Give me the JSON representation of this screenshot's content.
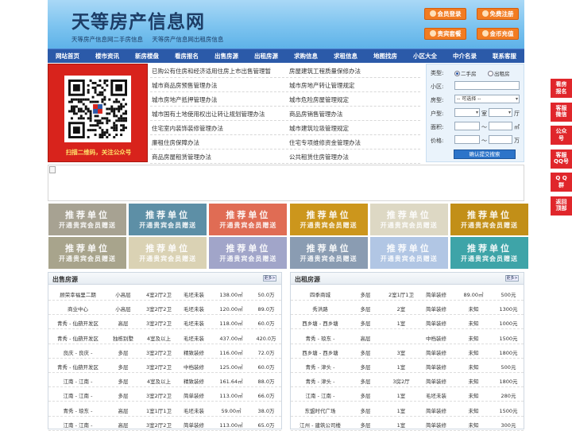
{
  "header": {
    "title": "天等房产信息网",
    "subtitle": [
      "天等房产信息网二手房信息",
      "天等房产信息网出租房信息"
    ],
    "buttons": [
      {
        "label": "会员登录",
        "icon": "user-icon"
      },
      {
        "label": "免费注册",
        "icon": "register-icon"
      },
      {
        "label": "贵宾套餐",
        "icon": "vip-icon"
      },
      {
        "label": "金币充值",
        "icon": "coin-icon"
      }
    ]
  },
  "nav": [
    "网站首页",
    "楼市资讯",
    "新房楼盘",
    "看房报名",
    "出售房源",
    "出租房源",
    "求购信息",
    "求租信息",
    "地图找房",
    "小区大全",
    "中介名录",
    "联系客服"
  ],
  "qr": {
    "caption": "扫描二维码，关注公众号"
  },
  "links": {
    "left": [
      "已购公有住房和经济适用住房上市出售管理暂",
      "城市商品房预售管理办法",
      "城市房地产抵押管理办法",
      "城市国有土地使用权出让转让规划管理办法",
      "住宅室内装饰装修管理办法",
      "廉租住房保障办法",
      "商品房屋租赁管理办法"
    ],
    "right": [
      "房屋建筑工程质量保修办法",
      "城市房地产转让管理规定",
      "城市危险房屋管理规定",
      "商品房销售管理办法",
      "城市建筑垃圾管理规定",
      "住宅专项维修资金管理办法",
      "公共租赁住房管理办法"
    ]
  },
  "search": {
    "type_label": "类型:",
    "type_options": [
      "二手房",
      "出租房"
    ],
    "community_label": "小区:",
    "house_type_label": "房型:",
    "house_type_value": "-- 可选择 --",
    "layout_label": "户型:",
    "room_unit": "室",
    "hall_unit": "厅",
    "area_label": "面积:",
    "range_sep": "～",
    "area_unit": "㎡",
    "price_label": "价格:",
    "price_unit": "万",
    "submit": "确认提交搜索"
  },
  "ads": {
    "line1": "推荐单位",
    "line2": "开通贵宾会员赠送",
    "colors": [
      "#a7a292",
      "#5d8fa6",
      "#e06c54",
      "#cc961c",
      "#ddd8c4",
      "#c28f18",
      "#a8a48c",
      "#dad2b4",
      "#a1a5c9",
      "#8a9cb2",
      "#b1c6e4",
      "#3ea4a8"
    ]
  },
  "sale": {
    "title": "出售房源",
    "more": "更多>",
    "rows": [
      [
        "顾荣幸福里二期",
        "小高层",
        "4室2厅2卫",
        "毛坯未装",
        "138.00㎡",
        "50.0万"
      ],
      [
        "商业中心",
        "小高层",
        "3室2厅2卫",
        "毛坯未装",
        "120.00㎡",
        "89.0万"
      ],
      [
        "青秀 - 仙葫开发区",
        "高层",
        "3室2厅2卫",
        "毛坯未装",
        "118.00㎡",
        "60.0万"
      ],
      [
        "青秀 - 仙葫开发区",
        "独栋别墅",
        "4室及以上",
        "毛坯未装",
        "437.00㎡",
        "420.0万"
      ],
      [
        "良庆 - 良庆 -",
        "多层",
        "3室2厅2卫",
        "精致装修",
        "116.00㎡",
        "72.0万"
      ],
      [
        "青秀 - 仙葫开发区",
        "多层",
        "3室2厅2卫",
        "中档装修",
        "125.00㎡",
        "60.0万"
      ],
      [
        "江南 - 江南 -",
        "多层",
        "4室及以上",
        "精致装修",
        "161.64㎡",
        "88.0万"
      ],
      [
        "江南 - 江南 -",
        "多层",
        "3室2厅2卫",
        "简单装修",
        "113.00㎡",
        "66.0万"
      ],
      [
        "青秀 - 琅东 -",
        "高层",
        "1室1厅1卫",
        "毛坯未装",
        "59.00㎡",
        "38.0万"
      ],
      [
        "江南 - 江南 -",
        "高层",
        "3室2厅2卫",
        "简单装修",
        "113.00㎡",
        "65.0万"
      ]
    ]
  },
  "rent": {
    "title": "出租房源",
    "more": "更多>",
    "rows": [
      [
        "四季商城",
        "多层",
        "2室1厅1卫",
        "简单装修",
        "89.00㎡",
        "500元"
      ],
      [
        "秀洪路",
        "多层",
        "2室",
        "简单装修",
        "未知",
        "1300元"
      ],
      [
        "西乡塘 - 西乡塘",
        "多层",
        "1室",
        "简单装修",
        "未知",
        "1000元"
      ],
      [
        "青秀 - 琅东 -",
        "高层",
        "",
        "中档装修",
        "未知",
        "1500元"
      ],
      [
        "西乡塘 - 西乡塘",
        "多层",
        "3室",
        "简单装修",
        "未知",
        "1800元"
      ],
      [
        "青秀 - 津头 -",
        "多层",
        "1室",
        "简单装修",
        "未知",
        "500元"
      ],
      [
        "青秀 - 津头 -",
        "多层",
        "3房2厅",
        "简单装修",
        "未知",
        "1800元"
      ],
      [
        "江南 - 江南 -",
        "多层",
        "1室",
        "毛坯未装",
        "未知",
        "280元"
      ],
      [
        "东盟时代广场",
        "多层",
        "1室",
        "简单装修",
        "未知",
        "1500元"
      ],
      [
        "江州 - 建筑公司楼",
        "多层",
        "1室",
        "简单装修",
        "未知",
        "300元"
      ]
    ]
  },
  "side": [
    {
      "label": [
        "看房",
        "报名"
      ],
      "color": "#e0262b"
    },
    {
      "label": [
        "客服",
        "微信"
      ],
      "color": "#e0262b"
    },
    {
      "label": [
        "公众",
        "号"
      ],
      "color": "#e0262b"
    },
    {
      "label": [
        "客服",
        "QQ号"
      ],
      "color": "#e0262b"
    },
    {
      "label": [
        "Q Q",
        "群"
      ],
      "color": "#e0262b"
    },
    {
      "label": [
        "返回",
        "顶部"
      ],
      "color": "#e0262b"
    }
  ]
}
